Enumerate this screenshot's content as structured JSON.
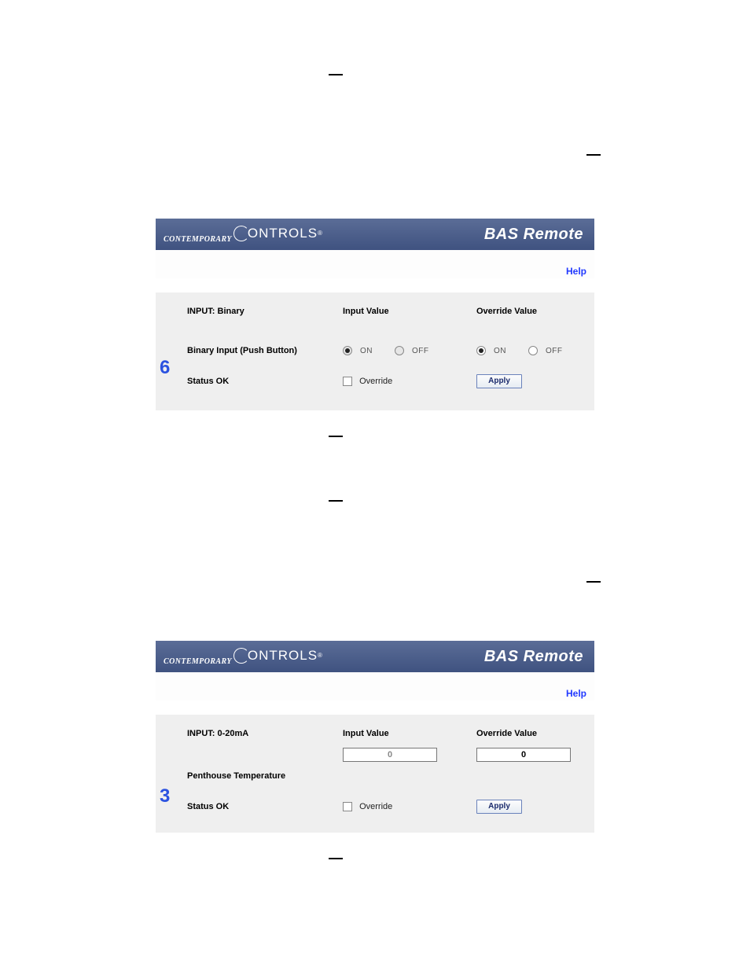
{
  "brand": {
    "contemp": "CONTEMPORARY",
    "controls": "ONTROLS",
    "reg": "®"
  },
  "product_title": "BAS Remote",
  "help_label": "Help",
  "panel1": {
    "channel": "6",
    "headers": {
      "type": "INPUT: Binary",
      "input": "Input Value",
      "override": "Override Value"
    },
    "name": "Binary Input (Push Button)",
    "status": "Status OK",
    "value_on": "ON",
    "value_off": "OFF",
    "override_cb": "Override",
    "apply": "Apply"
  },
  "panel2": {
    "channel": "3",
    "headers": {
      "type": "INPUT: 0-20mA",
      "input": "Input Value",
      "override": "Override Value"
    },
    "name": "Penthouse Temperature",
    "status": "Status OK",
    "input_value": "0",
    "override_value": "0",
    "override_cb": "Override",
    "apply": "Apply"
  }
}
